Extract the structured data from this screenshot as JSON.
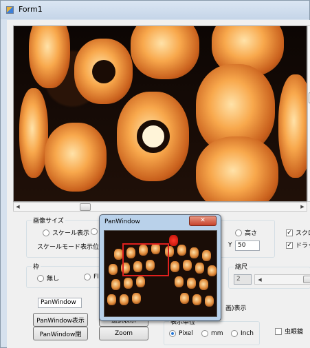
{
  "window": {
    "title": "Form1"
  },
  "image_group": {
    "label": "画像サイズ",
    "radio_scale": "スケール表示",
    "radio_height": "高さ",
    "mode_label": "スケールモード表示位置",
    "y_label": "Y",
    "y_value": "50"
  },
  "frame_group": {
    "label": "枠",
    "radio_none": "無し",
    "radio_flat": "Fla"
  },
  "scale_group": {
    "label": "縮尺",
    "value": "2"
  },
  "checks": {
    "scroll": "スクロ",
    "drag": "ドラッ",
    "magnifier": "虫眼鏡"
  },
  "pan_textbox_value": "PanWindow",
  "buttons": {
    "pan_show": "PanWindow表示",
    "pan_close": "PanWindow閉",
    "zoom": "Zoom",
    "hidden_under": "選択表示"
  },
  "unit_group": {
    "label": "表示単位",
    "pixel": "Pixel",
    "mm": "mm",
    "inch": "Inch"
  },
  "hidden_label": "画)表示",
  "pan_window": {
    "title": "PanWindow",
    "close_glyph": "✕"
  }
}
